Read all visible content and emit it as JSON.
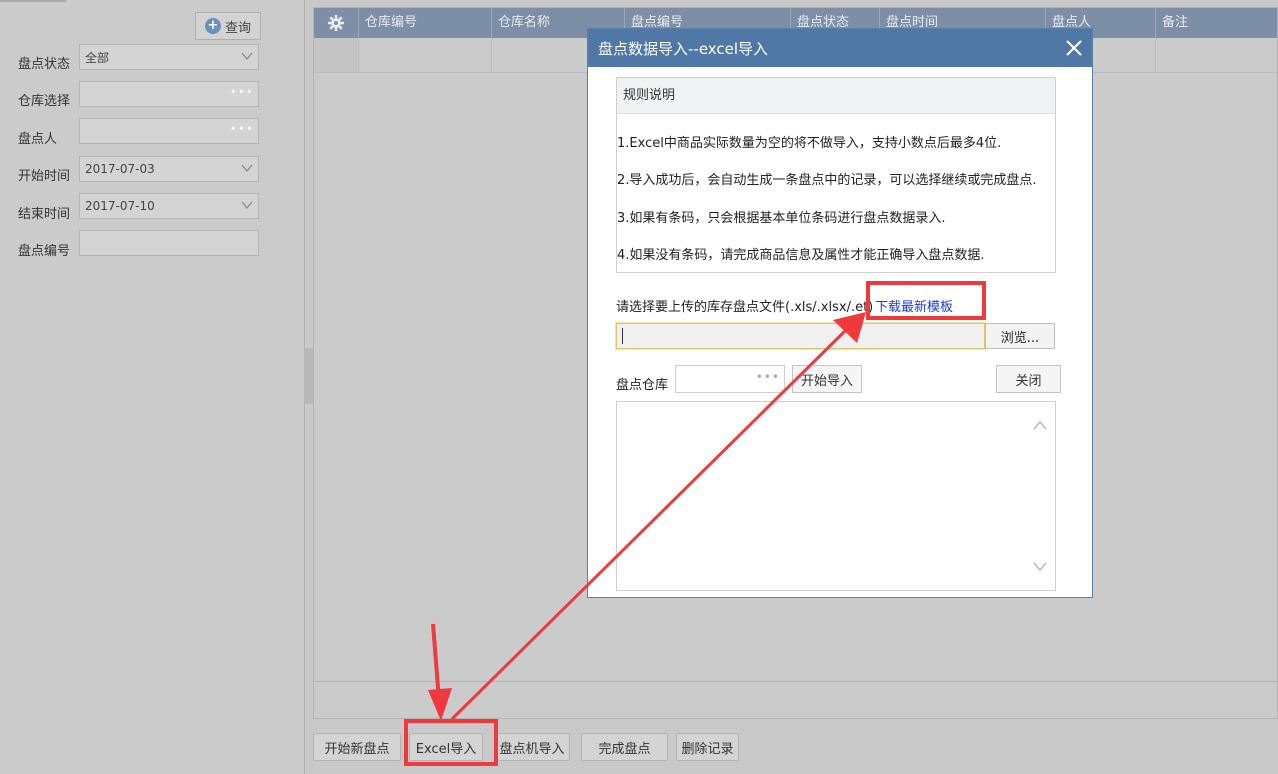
{
  "filters": {
    "query_label": "查询",
    "status_label": "盘点状态",
    "status_value": "全部",
    "warehouse_label": "仓库选择",
    "person_label": "盘点人",
    "start_label": "开始时间",
    "start_value": "2017-07-03",
    "end_label": "结束时间",
    "end_value": "2017-07-10",
    "number_label": "盘点编号"
  },
  "grid": {
    "columns": [
      "仓库编号",
      "仓库名称",
      "盘点编号",
      "盘点状态",
      "盘点时间",
      "盘点人",
      "备注"
    ]
  },
  "actions": {
    "new_check": "开始新盘点",
    "excel_import": "Excel导入",
    "device_import": "盘点机导入",
    "finish_check": "完成盘点",
    "delete_record": "删除记录"
  },
  "dialog": {
    "title": "盘点数据导入--excel导入",
    "rules_title": "规则说明",
    "rules": [
      "1.Excel中商品实际数量为空的将不做导入，支持小数点后最多4位.",
      "2.导入成功后，会自动生成一条盘点中的记录，可以选择继续或完成盘点.",
      "3.如果有条码，只会根据基本单位条码进行盘点数据录入.",
      "4.如果没有条码，请完成商品信息及属性才能正确导入盘点数据."
    ],
    "upload_prompt": "请选择要上传的库存盘点文件(.xls/.xlsx/.et)",
    "download_link": "下载最新模板",
    "browse_label": "浏览...",
    "warehouse_label": "盘点仓库",
    "start_import_label": "开始导入",
    "close_label": "关闭"
  },
  "colors": {
    "header": "#7d8fa6",
    "dialog_title": "#4f78a6",
    "highlight": "#f0393d",
    "link": "#1a3fd6"
  }
}
